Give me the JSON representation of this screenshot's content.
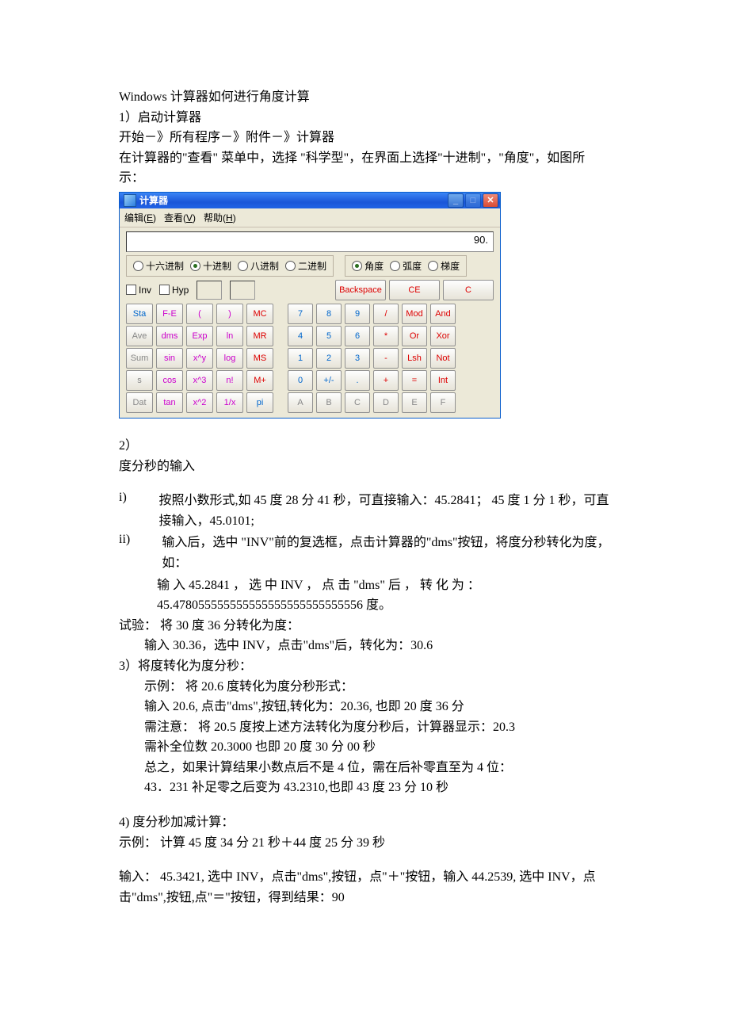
{
  "doc": {
    "title": "Windows 计算器如何进行角度计算",
    "s1": "1）启动计算器",
    "s1a": " 开始－》所有程序－》附件－》计算器",
    "s1b": "在计算器的\"查看\"  菜单中，选择 \"科学型\"，在界面上选择\"十进制\"，\"角度\"，如图所示：",
    "s2": "2）",
    "s2a": "度分秒的输入",
    "i1n": "i)",
    "i1": "按照小数形式,如 45 度 28 分 41 秒，可直接输入：45.2841；  45 度 1 分 1 秒，可直接输入，45.0101;",
    "i2n": "ii)",
    "i2": "输入后，选中 \"INV\"前的复选框，点击计算器的\"dms\"按钮，将度分秒转化为度，如：",
    "i2b": "输 入 45.2841 ， 选 中 INV ， 点 击 \"dms\" 后 ， 转 化 为 ：45.478055555555555555555555555556 度。",
    "t1": "试验：  将 30 度 36 分转化为度：",
    "t1a": "     输入 30.36，选中 INV，点击\"dms\"后，转化为：30.6",
    "s3": "3）将度转化为度分秒：",
    "s3a": "示例：  将 20.6 度转化为度分秒形式：",
    "s3b": "输入 20.6,  点击\"dms\",按钮,转化为：20.36,  也即 20 度 36 分",
    "s3c": "需注意：  将 20.5 度按上述方法转化为度分秒后，计算器显示：20.3",
    "s3d": "需补全位数  20.3000  也即  20 度 30 分 00 秒",
    "s3e": "总之，如果计算结果小数点后不是 4 位，需在后补零直至为 4 位：",
    "s3f": "43．231 补足零之后变为 43.2310,也即 43 度 23 分 10 秒",
    "s4": "4)  度分秒加减计算：",
    "s4a": "示例：  计算  45 度 34 分 21 秒＋44 度 25 分 39 秒",
    "s4b": "输入：  45.3421,  选中 INV，点击\"dms\",按钮，点\"＋\"按钮，输入 44.2539,  选中 INV，点击\"dms\",按钮,点\"＝\"按钮，得到结果：90"
  },
  "calc": {
    "title": "计算器",
    "menu": {
      "edit": "编辑(E)",
      "view": "查看(V)",
      "help": "帮助(H)"
    },
    "display": "90.",
    "bases": [
      "十六进制",
      "十进制",
      "八进制",
      "二进制"
    ],
    "base_sel": 1,
    "angles": [
      "角度",
      "弧度",
      "梯度"
    ],
    "angle_sel": 0,
    "chk": {
      "inv": "Inv",
      "hyp": "Hyp"
    },
    "clear": {
      "bs": "Backspace",
      "ce": "CE",
      "c": "C"
    },
    "left": [
      [
        "Sta",
        "F-E",
        "(",
        ")",
        "MC"
      ],
      [
        "Ave",
        "dms",
        "Exp",
        "ln",
        "MR"
      ],
      [
        "Sum",
        "sin",
        "x^y",
        "log",
        "MS"
      ],
      [
        "s",
        "cos",
        "x^3",
        "n!",
        "M+"
      ],
      [
        "Dat",
        "tan",
        "x^2",
        "1/x",
        "pi"
      ]
    ],
    "right": [
      [
        "7",
        "8",
        "9",
        "/",
        "Mod",
        "And"
      ],
      [
        "4",
        "5",
        "6",
        "*",
        "Or",
        "Xor"
      ],
      [
        "1",
        "2",
        "3",
        "-",
        "Lsh",
        "Not"
      ],
      [
        "0",
        "+/-",
        ".",
        "+",
        "=",
        "Int"
      ],
      [
        "A",
        "B",
        "C",
        "D",
        "E",
        "F"
      ]
    ]
  }
}
